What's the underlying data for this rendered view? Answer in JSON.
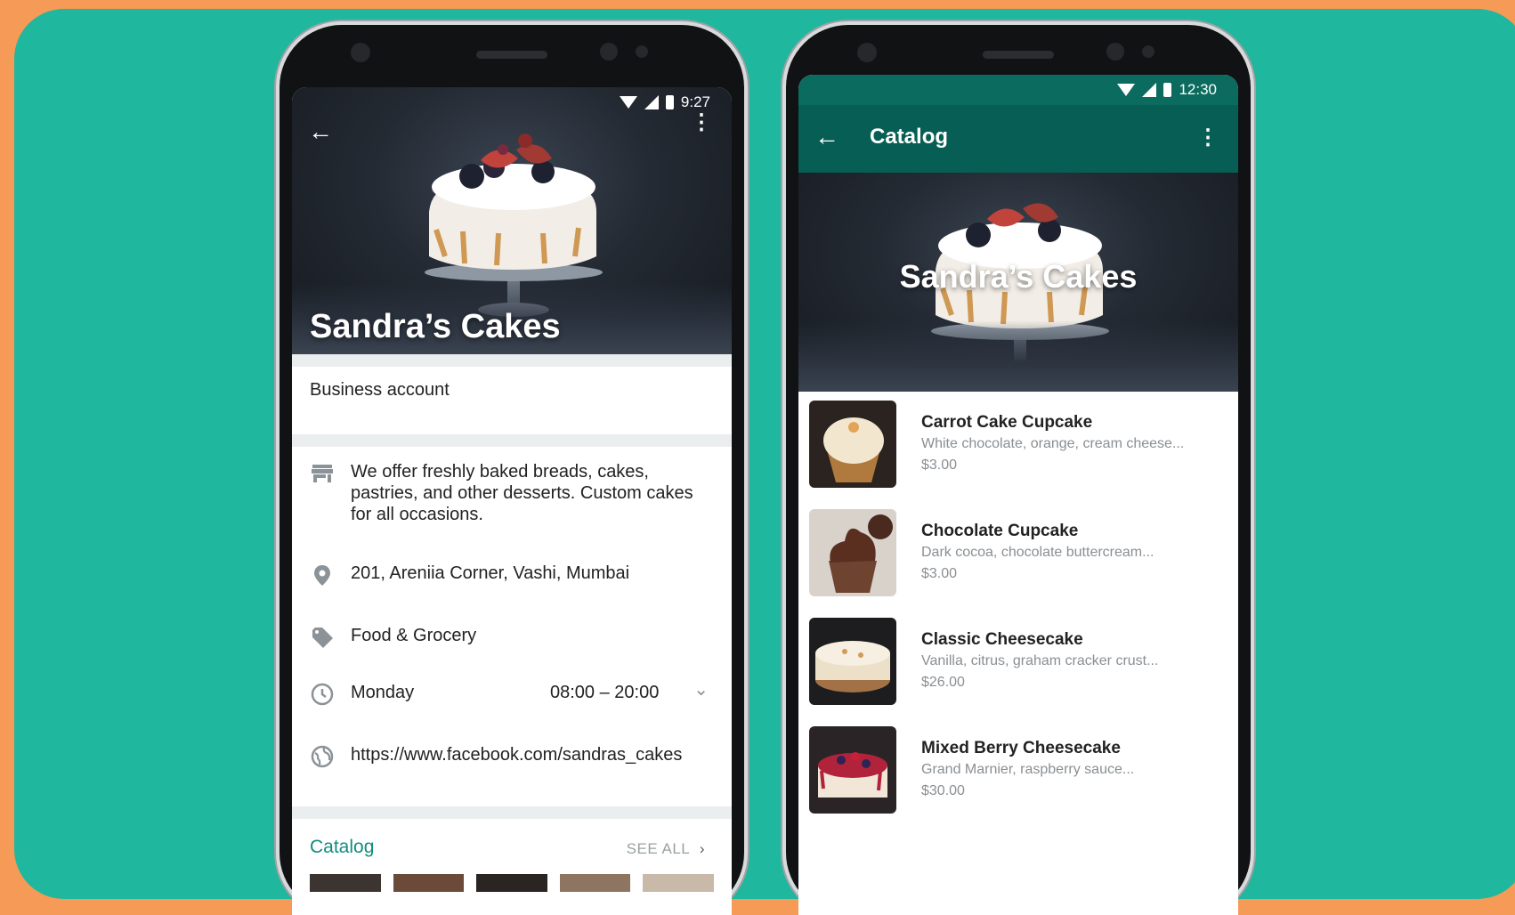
{
  "left_phone": {
    "status_time": "9:27",
    "title": "Sandra’s Cakes",
    "business_account": "Business account",
    "description": "We offer freshly baked breads, cakes, pastries, and other desserts. Custom cakes for all occasions.",
    "address": "201, Areniia Corner, Vashi, Mumbai",
    "category": "Food & Grocery",
    "hours_day": "Monday",
    "hours_time": "08:00 – 20:00",
    "website": "https://www.facebook.com/sandras_cakes",
    "catalog_label": "Catalog",
    "see_all": "SEE ALL"
  },
  "right_phone": {
    "status_time": "12:30",
    "appbar_title": "Catalog",
    "hero_title": "Sandra’s Cakes",
    "items": [
      {
        "name": "Carrot Cake Cupcake",
        "desc": "White chocolate, orange, cream cheese...",
        "price": "$3.00"
      },
      {
        "name": "Chocolate Cupcake",
        "desc": "Dark cocoa, chocolate buttercream...",
        "price": "$3.00"
      },
      {
        "name": "Classic Cheesecake",
        "desc": "Vanilla, citrus, graham cracker crust...",
        "price": "$26.00"
      },
      {
        "name": "Mixed Berry Cheesecake",
        "desc": "Grand Marnier, raspberry sauce...",
        "price": "$30.00"
      }
    ]
  },
  "colors": {
    "background_orange": "#f59a57",
    "panel_teal": "#1fb79d",
    "whatsapp_dark_green": "#075e54",
    "link_green": "#128c7e"
  }
}
